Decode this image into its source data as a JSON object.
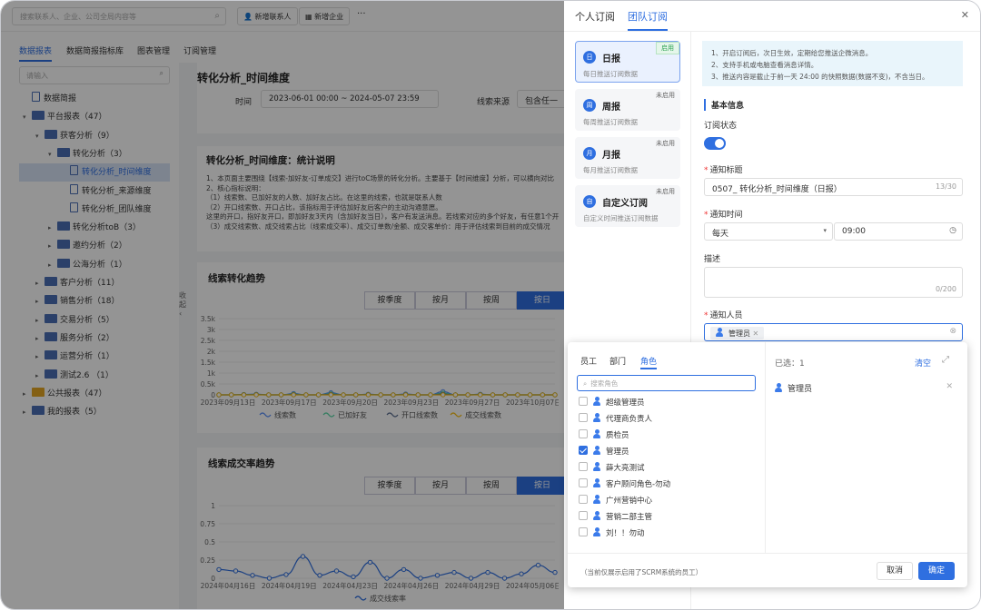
{
  "topbar": {
    "search_placeholder": "搜索联系人、企业、公司全局内容等",
    "add_contact": "新增联系人",
    "add_company": "新增企业",
    "more": "···"
  },
  "tabs": [
    "数据报表",
    "数据简报指标库",
    "图表管理",
    "订阅管理"
  ],
  "sidebar": {
    "search_placeholder": "请输入",
    "items": [
      {
        "label": "数据简报",
        "indent": 0,
        "kind": "doc"
      },
      {
        "label": "平台报表（47）",
        "indent": 0,
        "kind": "folder",
        "arrow": "▾"
      },
      {
        "label": "获客分析（9）",
        "indent": 1,
        "kind": "folder",
        "arrow": "▾"
      },
      {
        "label": "转化分析（3）",
        "indent": 2,
        "kind": "folder",
        "arrow": "▾"
      },
      {
        "label": "转化分析_时间维度",
        "indent": 3,
        "kind": "doc",
        "selected": true
      },
      {
        "label": "转化分析_来源维度",
        "indent": 3,
        "kind": "doc"
      },
      {
        "label": "转化分析_团队维度",
        "indent": 3,
        "kind": "doc"
      },
      {
        "label": "转化分析toB（3）",
        "indent": 2,
        "kind": "folder",
        "arrow": "▸"
      },
      {
        "label": "邀约分析（2）",
        "indent": 2,
        "kind": "folder",
        "arrow": "▸"
      },
      {
        "label": "公海分析（1）",
        "indent": 2,
        "kind": "folder",
        "arrow": "▸"
      },
      {
        "label": "客户分析（11）",
        "indent": 1,
        "kind": "folder",
        "arrow": "▸"
      },
      {
        "label": "销售分析（18）",
        "indent": 1,
        "kind": "folder",
        "arrow": "▸"
      },
      {
        "label": "交易分析（5）",
        "indent": 1,
        "kind": "folder",
        "arrow": "▸"
      },
      {
        "label": "服务分析（2）",
        "indent": 1,
        "kind": "folder",
        "arrow": "▸"
      },
      {
        "label": "运营分析（1）",
        "indent": 1,
        "kind": "folder",
        "arrow": "▸"
      },
      {
        "label": "测试2.6 （1）",
        "indent": 1,
        "kind": "folder",
        "arrow": "▸"
      },
      {
        "label": "公共报表（47）",
        "indent": 0,
        "kind": "folder",
        "arrow": "▸",
        "yellow": true
      },
      {
        "label": "我的报表（5）",
        "indent": 0,
        "kind": "folder",
        "arrow": "▸"
      }
    ],
    "collapse": "收起"
  },
  "main": {
    "title": "转化分析_时间维度",
    "time_label": "时间",
    "time_value": "2023-06-01 00:00 ~   2024-05-07 23:59",
    "source_label": "线索来源",
    "source_value": "包含任一",
    "desc_title": "转化分析_时间维度：统计说明",
    "desc_lines": [
      "1、本页面主要围绕【线索-加好友-订单成交】进行toC场景的转化分析。主要基于【时间维度】分析，可以横向对比",
      "2、核心指标说明：",
      "（1）线索数、已加好友的人数、加好友占比。在这里的线索，也就是联系人数",
      "（2）开口线索数、开口占比，该指标用于评估加好友后客户的主动沟通意愿。",
      "这里的开口，指好友开口，即加好友3天内（含加好友当日），客户有发送消息。若线索对应的多个好友，有任意1个开",
      "（3）成交线索数、成交线索占比（线索成交率）、成交订单数/金额、成交客单价：用于评估线索到目前的成交情况"
    ],
    "chart1_title": "线索转化趋势",
    "chart2_title": "线索成交率趋势",
    "segments": [
      "按季度",
      "按月",
      "按周",
      "按日"
    ]
  },
  "chart_data": [
    {
      "type": "line",
      "title": "线索转化趋势",
      "y_ticks": [
        "3.5k",
        "3k",
        "2.5k",
        "2k",
        "1.5k",
        "1k",
        "0.5k",
        "0"
      ],
      "ylim": [
        0,
        3500
      ],
      "categories": [
        "2023年09月13日",
        "2023年09月17日",
        "2023年09月20日",
        "2023年09月23日",
        "2023年09月27日",
        "2023年10月07日"
      ],
      "x": [
        0,
        1,
        2,
        3,
        4,
        5,
        6,
        7,
        8,
        9,
        10,
        11,
        12,
        13,
        14,
        15,
        16,
        17,
        18,
        19,
        20,
        21,
        22,
        23,
        24,
        25,
        26,
        27
      ],
      "series": [
        {
          "name": "线索数",
          "color": "#5b8ff9",
          "values": [
            0,
            0,
            20,
            30,
            0,
            0,
            60,
            0,
            0,
            100,
            0,
            0,
            30,
            0,
            0,
            40,
            0,
            0,
            150,
            0,
            0,
            30,
            0,
            0,
            0,
            0,
            0,
            0
          ]
        },
        {
          "name": "已加好友",
          "color": "#5ad8a6",
          "values": [
            0,
            0,
            10,
            20,
            0,
            0,
            30,
            0,
            0,
            50,
            0,
            0,
            20,
            0,
            0,
            20,
            0,
            0,
            80,
            0,
            0,
            20,
            0,
            0,
            0,
            0,
            0,
            0
          ]
        },
        {
          "name": "开口线索数",
          "color": "#5d7092",
          "values": [
            0,
            0,
            5,
            10,
            0,
            0,
            10,
            0,
            0,
            20,
            0,
            0,
            10,
            0,
            0,
            10,
            0,
            0,
            30,
            0,
            0,
            10,
            0,
            0,
            0,
            0,
            0,
            0
          ]
        },
        {
          "name": "成交线索数",
          "color": "#f6bd16",
          "values": [
            0,
            0,
            0,
            0,
            0,
            0,
            0,
            0,
            0,
            0,
            0,
            0,
            0,
            0,
            0,
            0,
            0,
            0,
            0,
            0,
            0,
            0,
            0,
            0,
            0,
            0,
            0,
            0
          ]
        }
      ]
    },
    {
      "type": "line",
      "title": "线索成交率趋势",
      "y_ticks": [
        "1",
        "0.75",
        "0.5",
        "0.25",
        "0"
      ],
      "ylim": [
        0,
        1
      ],
      "categories": [
        "2024年04月16日",
        "2024年04月19日",
        "2024年04月23日",
        "2024年04月26日",
        "2024年04月29日",
        "2024年05月06日"
      ],
      "x": [
        0,
        1,
        2,
        3,
        4,
        5,
        6,
        7,
        8,
        9,
        10,
        11,
        12,
        13,
        14,
        15,
        16,
        17,
        18,
        19,
        20
      ],
      "series": [
        {
          "name": "成交线索率",
          "color": "#2f6fe0",
          "values": [
            0.12,
            0.1,
            0.04,
            0.0,
            0.05,
            0.3,
            0.04,
            0.1,
            0.02,
            0.22,
            0.0,
            0.12,
            0.0,
            0.04,
            0.08,
            0.0,
            0.08,
            0.0,
            0.06,
            0.18,
            0.08
          ]
        }
      ]
    }
  ],
  "panel": {
    "tabs": [
      "个人订阅",
      "团队订阅"
    ],
    "close": "✕",
    "subs": [
      {
        "name": "日报",
        "desc": "每日推送订阅数据",
        "badge": "启用",
        "on": true,
        "icon": "日"
      },
      {
        "name": "周报",
        "desc": "每周推送订阅数据",
        "badge": "未启用",
        "on": false,
        "icon": "周"
      },
      {
        "name": "月报",
        "desc": "每月推送订阅数据",
        "badge": "未启用",
        "on": false,
        "icon": "月"
      },
      {
        "name": "自定义订阅",
        "desc": "自定义时间推送订阅数据",
        "badge": "未启用",
        "on": false,
        "icon": "自"
      }
    ],
    "notice": [
      "1、开启订阅后，次日生效，定期给您推送企微消息。",
      "2、支持手机或电脑查看消息详情。",
      "3、推送内容是截止于前一天 24:00 的快照数据(数据不变)，不含当日。"
    ],
    "section": "基本信息",
    "status_label": "订阅状态",
    "title_label": "通知标题",
    "title_value": "0507_ 转化分析_时间维度（日报）",
    "title_count": "13/30",
    "time_label": "通知时间",
    "freq_value": "每天",
    "time_value": "09:00",
    "desc_label": "描述",
    "desc_count": "0/200",
    "people_label": "通知人员",
    "people_tag": "管理员"
  },
  "dropdown": {
    "tabs": [
      "员工",
      "部门",
      "角色"
    ],
    "search_placeholder": "搜索角色",
    "options": [
      {
        "label": "超级管理员",
        "checked": false
      },
      {
        "label": "代理商负责人",
        "checked": false
      },
      {
        "label": "质检员",
        "checked": false
      },
      {
        "label": "管理员",
        "checked": true
      },
      {
        "label": "薛大亮测试",
        "checked": false
      },
      {
        "label": "客户顾问角色-勿动",
        "checked": false
      },
      {
        "label": "广州营销中心",
        "checked": false
      },
      {
        "label": "营销二部主管",
        "checked": false
      },
      {
        "label": "刘！！勿动",
        "checked": false
      }
    ],
    "selected_label": "已选：1",
    "clear": "清空",
    "selected": [
      "管理员"
    ],
    "footer_note": "（当前仅展示启用了SCRM系统的员工）",
    "cancel": "取消",
    "confirm": "确定"
  }
}
